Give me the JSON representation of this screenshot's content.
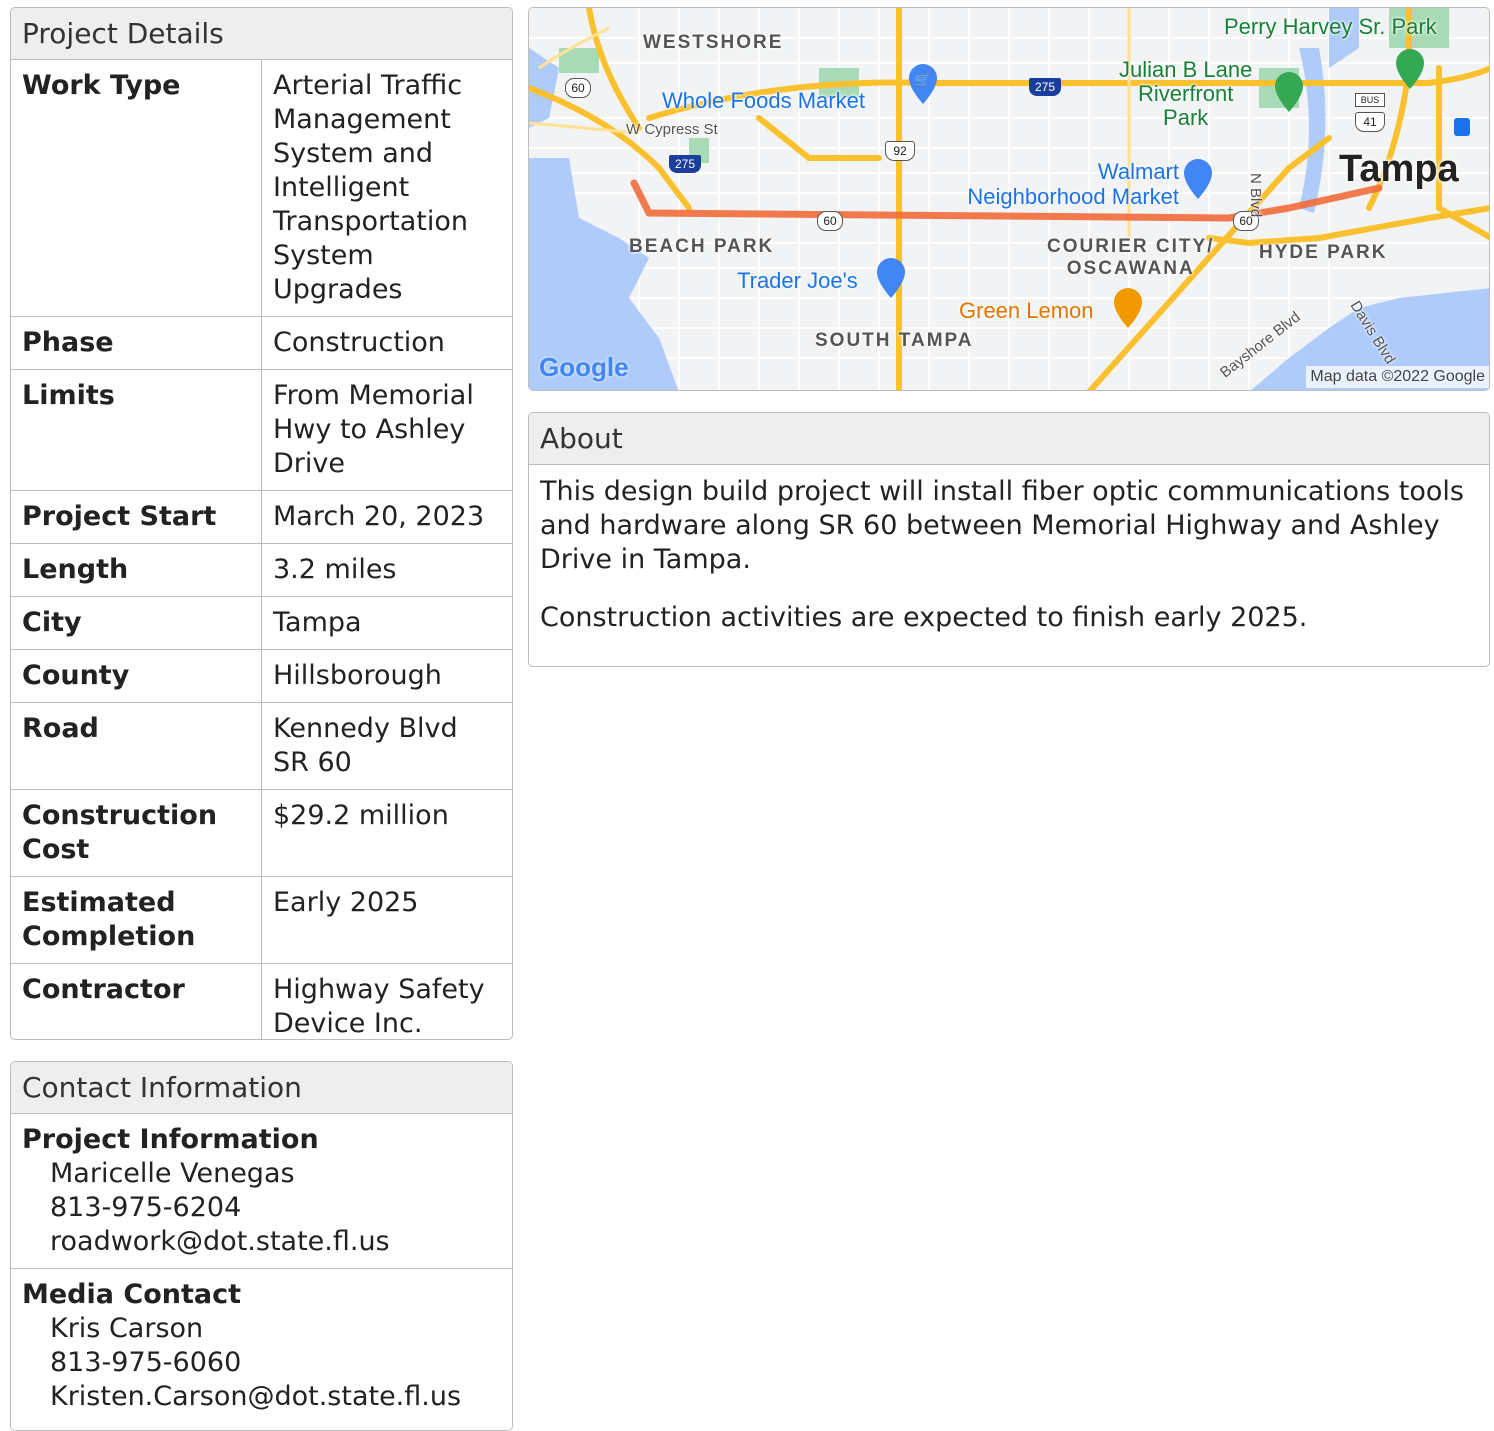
{
  "details": {
    "title": "Project Details",
    "rows": [
      {
        "label": "Work Type",
        "value": "Arterial Traffic Management System and Intelligent Transportation System Upgrades"
      },
      {
        "label": "Phase",
        "value": "Construction"
      },
      {
        "label": "Limits",
        "value": "From Memorial Hwy to Ashley Drive"
      },
      {
        "label": "Project Start",
        "value": "March 20, 2023"
      },
      {
        "label": "Length",
        "value": "3.2 miles"
      },
      {
        "label": "City",
        "value": "Tampa"
      },
      {
        "label": "County",
        "value": "Hillsborough"
      },
      {
        "label": "Road",
        "value": "Kennedy Blvd\nSR 60"
      },
      {
        "label": "Construction Cost",
        "value": "$29.2 million"
      },
      {
        "label": "Estimated Completion",
        "value": "Early 2025"
      },
      {
        "label": "Contractor",
        "value": "Highway Safety Device Inc."
      }
    ]
  },
  "contact": {
    "title": "Contact Information",
    "blocks": [
      {
        "title": "Project Information",
        "name": "Maricelle Venegas",
        "phone": "813-975-6204",
        "email": "roadwork@dot.state.fl.us"
      },
      {
        "title": "Media Contact",
        "name": "Kris Carson",
        "phone": "813-975-6060",
        "email": "Kristen.Carson@dot.state.fl.us"
      }
    ]
  },
  "about": {
    "title": "About",
    "paragraphs": [
      "This design build project will install fiber optic communications tools and hardware along SR 60 between Memorial Highway and Ashley Drive in Tampa.",
      "Construction activities are expected to finish early 2025."
    ]
  },
  "map": {
    "labels": {
      "westshore": "WESTSHORE",
      "perry_harvey": "Perry Harvey Sr. Park",
      "julian_lane": "Julian B Lane\nRiverfront\nPark",
      "whole_foods": "Whole Foods Market",
      "w_cypress": "W Cypress St",
      "walmart": "Walmart\nNeighborhood Market",
      "tampa": "Tampa",
      "n_blvd": "N Blvd",
      "beach_park": "BEACH PARK",
      "courier_city": "COURIER CITY/\nOSCAWANA",
      "hyde_park": "HYDE PARK",
      "trader_joes": "Trader Joe's",
      "green_lemon": "Green Lemon",
      "south_tampa": "SOUTH TAMPA",
      "bayshore": "Bayshore Blvd",
      "davis": "Davis Blvd",
      "google": "Google",
      "attribution": "Map data ©2022 Google"
    },
    "shields": {
      "sr60": "60",
      "i275": "275",
      "us92": "92",
      "us41": "41",
      "bus": "BUS"
    },
    "colors": {
      "route": "#f26b3a",
      "highway": "#fbc02d",
      "water": "#aecbfa",
      "park": "#a8dab5",
      "land": "#f1f3f4"
    }
  }
}
